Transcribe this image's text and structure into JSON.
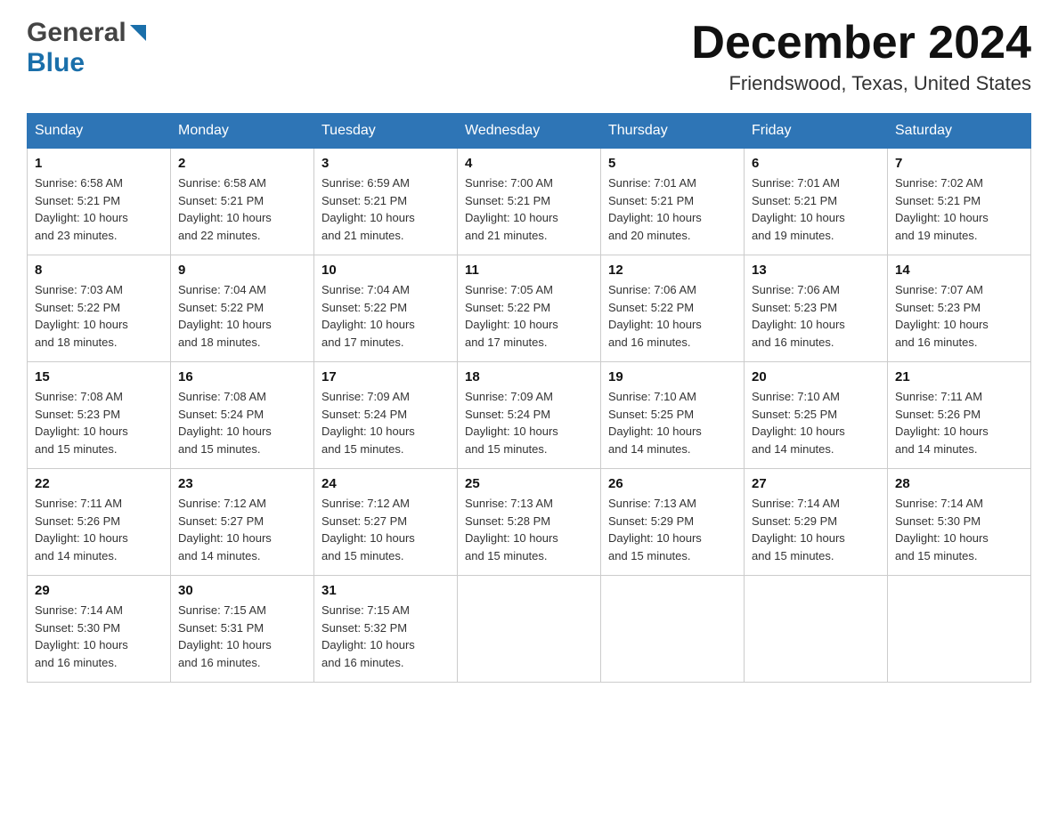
{
  "header": {
    "logo": {
      "line1": "General",
      "line2": "Blue"
    },
    "month_title": "December 2024",
    "location": "Friendswood, Texas, United States"
  },
  "days_of_week": [
    "Sunday",
    "Monday",
    "Tuesday",
    "Wednesday",
    "Thursday",
    "Friday",
    "Saturday"
  ],
  "weeks": [
    [
      {
        "day": "1",
        "sunrise": "6:58 AM",
        "sunset": "5:21 PM",
        "daylight": "10 hours and 23 minutes."
      },
      {
        "day": "2",
        "sunrise": "6:58 AM",
        "sunset": "5:21 PM",
        "daylight": "10 hours and 22 minutes."
      },
      {
        "day": "3",
        "sunrise": "6:59 AM",
        "sunset": "5:21 PM",
        "daylight": "10 hours and 21 minutes."
      },
      {
        "day": "4",
        "sunrise": "7:00 AM",
        "sunset": "5:21 PM",
        "daylight": "10 hours and 21 minutes."
      },
      {
        "day": "5",
        "sunrise": "7:01 AM",
        "sunset": "5:21 PM",
        "daylight": "10 hours and 20 minutes."
      },
      {
        "day": "6",
        "sunrise": "7:01 AM",
        "sunset": "5:21 PM",
        "daylight": "10 hours and 19 minutes."
      },
      {
        "day": "7",
        "sunrise": "7:02 AM",
        "sunset": "5:21 PM",
        "daylight": "10 hours and 19 minutes."
      }
    ],
    [
      {
        "day": "8",
        "sunrise": "7:03 AM",
        "sunset": "5:22 PM",
        "daylight": "10 hours and 18 minutes."
      },
      {
        "day": "9",
        "sunrise": "7:04 AM",
        "sunset": "5:22 PM",
        "daylight": "10 hours and 18 minutes."
      },
      {
        "day": "10",
        "sunrise": "7:04 AM",
        "sunset": "5:22 PM",
        "daylight": "10 hours and 17 minutes."
      },
      {
        "day": "11",
        "sunrise": "7:05 AM",
        "sunset": "5:22 PM",
        "daylight": "10 hours and 17 minutes."
      },
      {
        "day": "12",
        "sunrise": "7:06 AM",
        "sunset": "5:22 PM",
        "daylight": "10 hours and 16 minutes."
      },
      {
        "day": "13",
        "sunrise": "7:06 AM",
        "sunset": "5:23 PM",
        "daylight": "10 hours and 16 minutes."
      },
      {
        "day": "14",
        "sunrise": "7:07 AM",
        "sunset": "5:23 PM",
        "daylight": "10 hours and 16 minutes."
      }
    ],
    [
      {
        "day": "15",
        "sunrise": "7:08 AM",
        "sunset": "5:23 PM",
        "daylight": "10 hours and 15 minutes."
      },
      {
        "day": "16",
        "sunrise": "7:08 AM",
        "sunset": "5:24 PM",
        "daylight": "10 hours and 15 minutes."
      },
      {
        "day": "17",
        "sunrise": "7:09 AM",
        "sunset": "5:24 PM",
        "daylight": "10 hours and 15 minutes."
      },
      {
        "day": "18",
        "sunrise": "7:09 AM",
        "sunset": "5:24 PM",
        "daylight": "10 hours and 15 minutes."
      },
      {
        "day": "19",
        "sunrise": "7:10 AM",
        "sunset": "5:25 PM",
        "daylight": "10 hours and 14 minutes."
      },
      {
        "day": "20",
        "sunrise": "7:10 AM",
        "sunset": "5:25 PM",
        "daylight": "10 hours and 14 minutes."
      },
      {
        "day": "21",
        "sunrise": "7:11 AM",
        "sunset": "5:26 PM",
        "daylight": "10 hours and 14 minutes."
      }
    ],
    [
      {
        "day": "22",
        "sunrise": "7:11 AM",
        "sunset": "5:26 PM",
        "daylight": "10 hours and 14 minutes."
      },
      {
        "day": "23",
        "sunrise": "7:12 AM",
        "sunset": "5:27 PM",
        "daylight": "10 hours and 14 minutes."
      },
      {
        "day": "24",
        "sunrise": "7:12 AM",
        "sunset": "5:27 PM",
        "daylight": "10 hours and 15 minutes."
      },
      {
        "day": "25",
        "sunrise": "7:13 AM",
        "sunset": "5:28 PM",
        "daylight": "10 hours and 15 minutes."
      },
      {
        "day": "26",
        "sunrise": "7:13 AM",
        "sunset": "5:29 PM",
        "daylight": "10 hours and 15 minutes."
      },
      {
        "day": "27",
        "sunrise": "7:14 AM",
        "sunset": "5:29 PM",
        "daylight": "10 hours and 15 minutes."
      },
      {
        "day": "28",
        "sunrise": "7:14 AM",
        "sunset": "5:30 PM",
        "daylight": "10 hours and 15 minutes."
      }
    ],
    [
      {
        "day": "29",
        "sunrise": "7:14 AM",
        "sunset": "5:30 PM",
        "daylight": "10 hours and 16 minutes."
      },
      {
        "day": "30",
        "sunrise": "7:15 AM",
        "sunset": "5:31 PM",
        "daylight": "10 hours and 16 minutes."
      },
      {
        "day": "31",
        "sunrise": "7:15 AM",
        "sunset": "5:32 PM",
        "daylight": "10 hours and 16 minutes."
      },
      null,
      null,
      null,
      null
    ]
  ]
}
